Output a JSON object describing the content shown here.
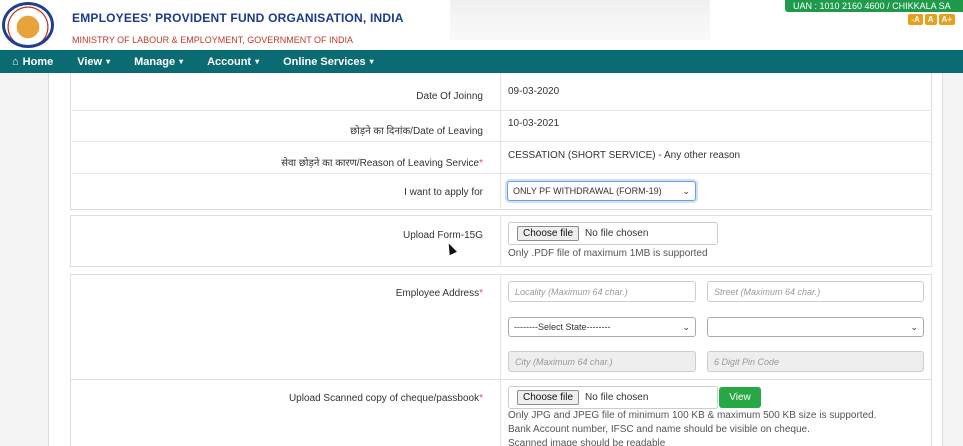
{
  "header": {
    "org_name": "EMPLOYEES' PROVIDENT FUND ORGANISATION, INDIA",
    "ministry": "MINISTRY OF LABOUR & EMPLOYMENT, GOVERNMENT OF INDIA",
    "uan_text": "UAN : 1010 2160 4600 / CHIKKALA SA",
    "font_buttons": [
      "-A",
      "A",
      "A+"
    ]
  },
  "navbar": {
    "home": "Home",
    "view": "View",
    "manage": "Manage",
    "account": "Account",
    "online_services": "Online Services"
  },
  "details": {
    "date_of_joining_label": "Date Of Joinng",
    "date_of_joining": "09-03-2020",
    "date_of_leaving_label": "छोड़ने का दिनांक/Date of Leaving",
    "date_of_leaving": "10-03-2021",
    "reason_label": "सेवा छोड़ने का कारण/Reason of Leaving Service",
    "reason": "CESSATION (SHORT SERVICE) - Any other reason",
    "apply_for_label": "I want to apply for",
    "apply_for_selected": "ONLY PF WITHDRAWAL (FORM-19)"
  },
  "form15g": {
    "label": "Upload Form-15G",
    "choose": "Choose file",
    "no_file": "No file chosen",
    "hint": "Only .PDF file of maximum 1MB is supported"
  },
  "address": {
    "label": "Employee Address",
    "locality_placeholder": "Locality (Maximum 64 char.)",
    "street_placeholder": "Street (Maximum 64 char.)",
    "state_selected": "--------Select State--------",
    "district_selected": "",
    "city_placeholder": "City (Maximum 64 char.)",
    "pin_placeholder": "6 Digit Pin Code"
  },
  "cheque": {
    "label": "Upload Scanned copy of cheque/passbook",
    "choose": "Choose file",
    "no_file": "No file chosen",
    "view": "View",
    "hint1": "Only JPG and JPEG file of minimum 100 KB & maximum 500 KB size is supported.",
    "hint2": "Bank Account number, IFSC and name should be visible on cheque.",
    "hint3": "Scanned image should be readable"
  },
  "colors": {
    "navbar": "#0b6b73",
    "brand_blue": "#1a3a8c",
    "ministry_red": "#c0392b",
    "view_button": "#28a745"
  }
}
